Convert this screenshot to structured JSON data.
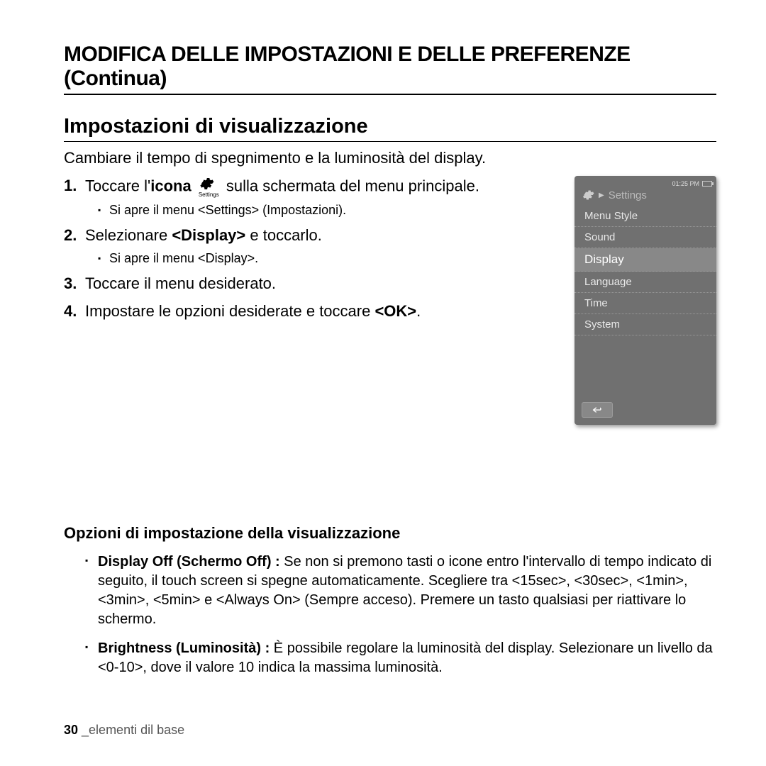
{
  "chapter_title": "MODIFICA DELLE IMPOSTAZIONI E DELLE PREFERENZE (Continua)",
  "section_title": "Impostazioni di visualizzazione",
  "intro": "Cambiare il tempo di spegnimento e la luminosità del display.",
  "steps": [
    {
      "pre": "Toccare l'",
      "bold_inline": "icona",
      "post": " sulla schermata del menu principale.",
      "icon_caption": "Settings",
      "sub": "Si apre il menu <Settings> (Impostazioni)."
    },
    {
      "text_pre": "Selezionare ",
      "text_bold": "<Display>",
      "text_post": " e toccarlo.",
      "sub": "Si apre il menu <Display>."
    },
    {
      "text": "Toccare il menu desiderato."
    },
    {
      "text_pre": "Impostare le opzioni desiderate e toccare ",
      "text_bold": "<OK>",
      "text_post": "."
    }
  ],
  "device": {
    "time": "01:25 PM",
    "header": "Settings",
    "items": [
      "Menu Style",
      "Sound",
      "Display",
      "Language",
      "Time",
      "System"
    ],
    "selected_index": 2
  },
  "options_title": "Opzioni di impostazione della visualizzazione",
  "options": [
    {
      "bold": "Display Off (Schermo Off) : ",
      "text": "Se non si premono tasti o icone entro l'intervallo di tempo indicato di seguito, il touch screen si spegne automaticamente. Scegliere tra <15sec>, <30sec>, <1min>, <3min>, <5min> e <Always On> (Sempre acceso). Premere un tasto qualsiasi per riattivare lo schermo."
    },
    {
      "bold": "Brightness (Luminosità) : ",
      "text": "È possibile regolare la luminosità del display. Selezionare un livello da <0-10>, dove il valore 10 indica la massima luminosità."
    }
  ],
  "footer": {
    "page": "30",
    "sep": " _",
    "section": "elementi dil base"
  }
}
